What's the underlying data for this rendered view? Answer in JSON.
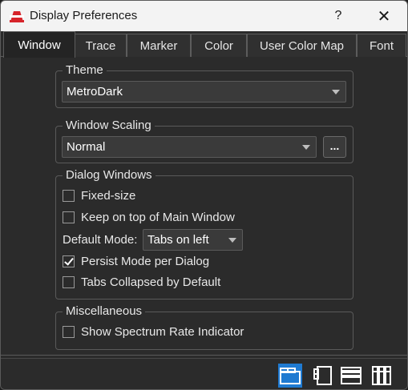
{
  "window": {
    "title": "Display Preferences",
    "help_label": "?",
    "close_label": "✕"
  },
  "tabs": [
    {
      "label": "Window",
      "active": true
    },
    {
      "label": "Trace",
      "active": false
    },
    {
      "label": "Marker",
      "active": false
    },
    {
      "label": "Color",
      "active": false
    },
    {
      "label": "User Color Map",
      "active": false
    },
    {
      "label": "Font",
      "active": false
    }
  ],
  "theme": {
    "group_title": "Theme",
    "value": "MetroDark"
  },
  "scaling": {
    "group_title": "Window Scaling",
    "value": "Normal",
    "more_label": "..."
  },
  "dialog": {
    "group_title": "Dialog Windows",
    "fixed_size": {
      "label": "Fixed-size",
      "checked": false
    },
    "keep_on_top": {
      "label": "Keep on top of Main Window",
      "checked": false
    },
    "default_mode_label": "Default Mode:",
    "default_mode_value": "Tabs on left",
    "persist_mode": {
      "label": "Persist Mode per Dialog",
      "checked": true
    },
    "tabs_collapsed": {
      "label": "Tabs Collapsed by Default",
      "checked": false
    }
  },
  "misc": {
    "group_title": "Miscellaneous",
    "spectrum_rate": {
      "label": "Show Spectrum Rate Indicator",
      "checked": false
    }
  },
  "footer": {
    "modes": [
      {
        "icon": "tabs-top-icon",
        "active": true
      },
      {
        "icon": "tabs-left-icon",
        "active": false
      },
      {
        "icon": "tabs-stacked-icon",
        "active": false
      },
      {
        "icon": "tabs-columns-icon",
        "active": false
      }
    ]
  },
  "colors": {
    "accent": "#1f7ad1",
    "background": "#2b2b2b",
    "titlebar": "#f3f3f3"
  }
}
